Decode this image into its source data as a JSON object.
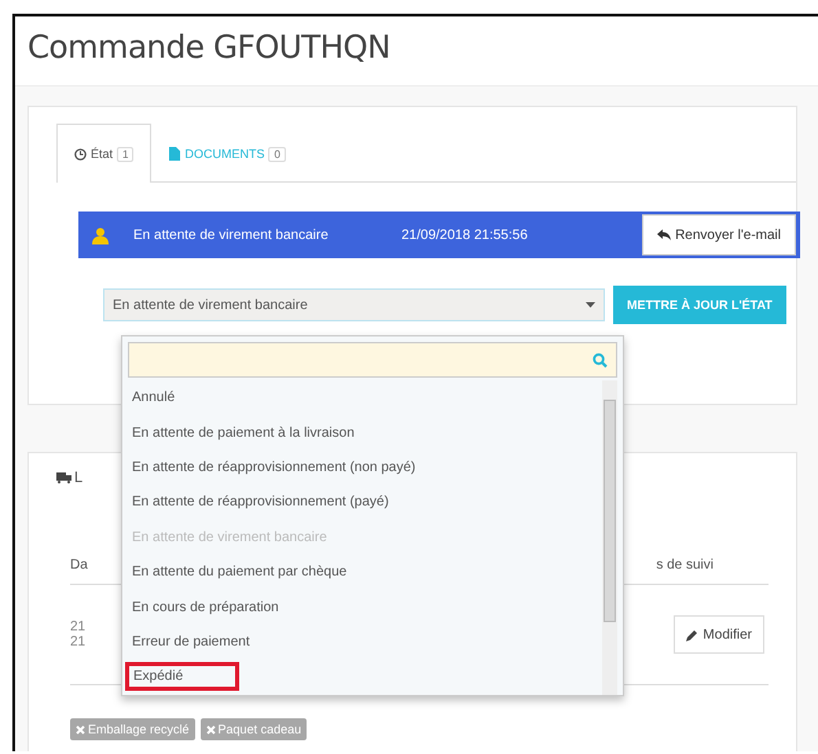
{
  "page": {
    "title": "Commande GFOUTHQN"
  },
  "tabs": [
    {
      "label": "État",
      "count": "1",
      "selected": true
    },
    {
      "label": "DOCUMENTS",
      "count": "0",
      "selected": false
    }
  ],
  "status": {
    "text": "En attente de virement bancaire",
    "date": "21/09/2018 21:55:56",
    "button": "Renvoyer l'e-mail"
  },
  "state_select": {
    "value": "En attente de virement bancaire",
    "button": "METTRE À JOUR L'ÉTAT"
  },
  "dropdown": {
    "options": [
      {
        "label": "Annulé",
        "disabled": false,
        "highlighted": false
      },
      {
        "label": "En attente de paiement à la livraison",
        "disabled": false,
        "highlighted": false
      },
      {
        "label": "En attente de réapprovisionnement (non payé)",
        "disabled": false,
        "highlighted": false
      },
      {
        "label": "En attente de réapprovisionnement (payé)",
        "disabled": false,
        "highlighted": false
      },
      {
        "label": "En attente de virement bancaire",
        "disabled": true,
        "highlighted": false
      },
      {
        "label": "En attente du paiement par chèque",
        "disabled": false,
        "highlighted": false
      },
      {
        "label": "En cours de préparation",
        "disabled": false,
        "highlighted": false
      },
      {
        "label": "Erreur de paiement",
        "disabled": false,
        "highlighted": false
      },
      {
        "label": "Expédié",
        "disabled": false,
        "highlighted": true
      }
    ]
  },
  "shipping": {
    "heading": "L",
    "columns": [
      "Da",
      "s de suivi"
    ],
    "row": {
      "lines": [
        "21",
        "21"
      ],
      "button": "Modifier"
    },
    "tags": [
      "Emballage recyclé",
      "Paquet cadeau"
    ]
  }
}
